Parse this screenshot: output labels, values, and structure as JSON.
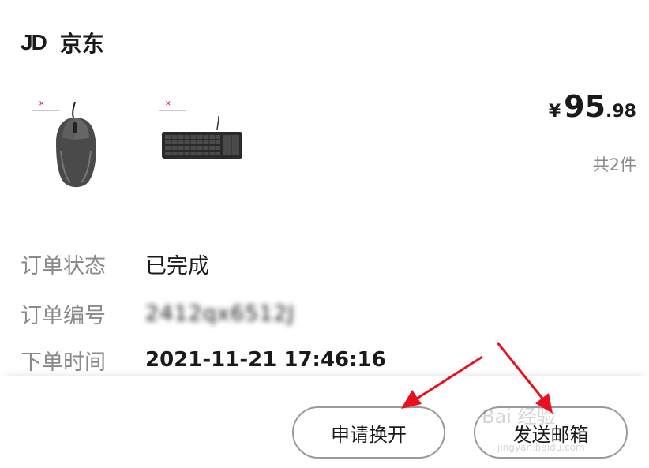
{
  "header": {
    "logo_text": "JD",
    "store_name": "京东"
  },
  "products": [
    {
      "name": "mouse",
      "icon": "mouse-product-image"
    },
    {
      "name": "keyboard",
      "icon": "keyboard-product-image"
    }
  ],
  "order": {
    "price_currency": "¥",
    "price_integer": "95",
    "price_decimal": ".98",
    "item_count": "共2件",
    "status_label": "订单状态",
    "status_value": "已完成",
    "number_label": "订单编号",
    "number_value": "2412qx6512J",
    "time_label": "下单时间",
    "time_value": "2021-11-21 17:46:16"
  },
  "actions": {
    "exchange_label": "申请换开",
    "email_label": "发送邮箱"
  },
  "watermark": {
    "text": "Bai 经验",
    "sub": "jingyan.baidu.com"
  },
  "colors": {
    "annotation_arrow": "#e8101e",
    "label_gray": "#8a8a8a",
    "button_border": "#9a9a9a"
  }
}
